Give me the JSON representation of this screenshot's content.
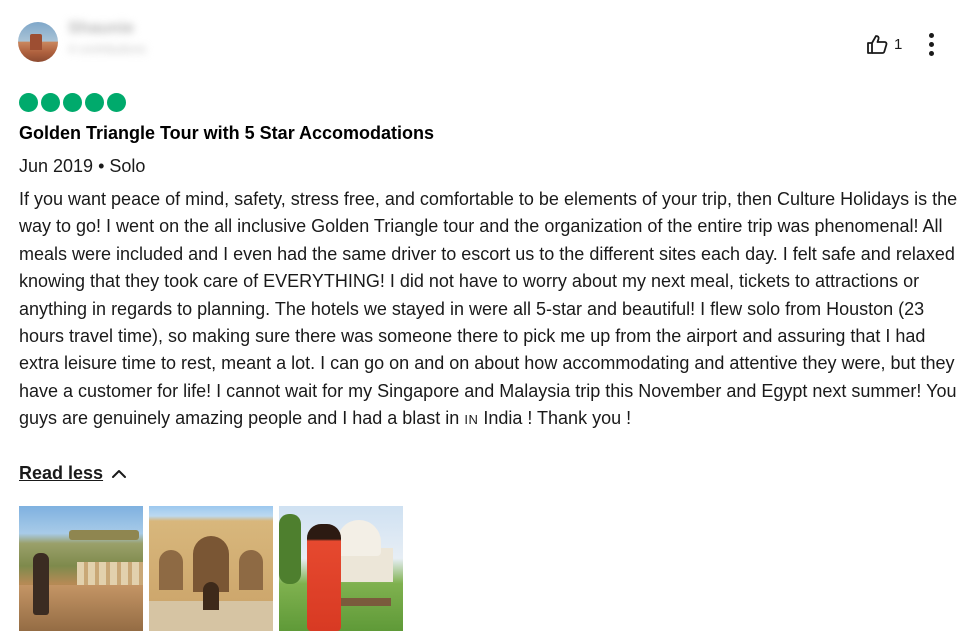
{
  "reviewer": {
    "name": "Shaunie",
    "contributions": "4 contributions"
  },
  "actions": {
    "helpful_icon": "thumbs-up-icon",
    "helpful_count": "1",
    "more_icon": "more-vertical-icon"
  },
  "rating": {
    "value": 5,
    "max": 5,
    "color": "#00aa6c"
  },
  "review": {
    "title": "Golden Triangle Tour with 5 Star Accomodations",
    "meta": "Jun 2019 • Solo",
    "body": "If you want peace of mind, safety, stress free, and comfortable to be elements of your trip, then Culture Holidays is the way to go! I went on the all inclusive Golden Triangle tour and the organization of the entire trip was phenomenal! All meals were included and I even had the same driver to escort us to the different sites each day. I felt safe and relaxed knowing that they took care of EVERYTHING! I did not have to worry about my next meal, tickets to attractions or anything in regards to planning. The hotels we stayed in were all 5-star and beautiful! I flew solo from Houston (23 hours travel time), so making sure there was someone there to pick me up from the airport and assuring that I had extra leisure time to rest, meant a lot. I can go on and on about how accommodating and attentive they were, but they have a customer for life! I cannot wait for my Singapore and Malaysia trip this November and Egypt next summer! You guys are genuinely amazing people and I had a blast in",
    "body_tag": "IN",
    "body_end": " India ! Thank you !",
    "toggle_label": "Read less",
    "toggle_icon": "chevron-up-icon"
  },
  "photos": [
    {
      "subject": "fort-landscape-photo"
    },
    {
      "subject": "palace-gate-photo"
    },
    {
      "subject": "taj-mahal-photo"
    }
  ]
}
